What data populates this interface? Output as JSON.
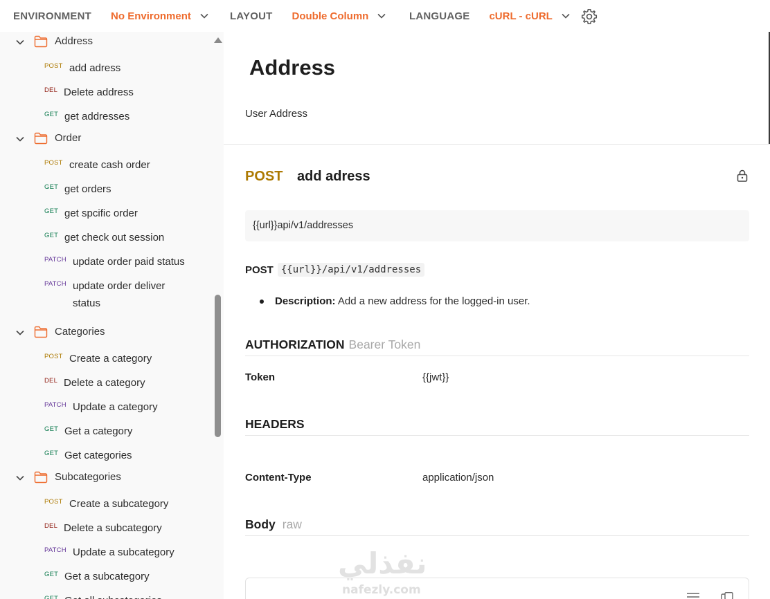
{
  "topbar": {
    "environment_label": "ENVIRONMENT",
    "environment_value": "No Environment",
    "layout_label": "LAYOUT",
    "layout_value": "Double Column",
    "language_label": "LANGUAGE",
    "language_value": "cURL - cURL",
    "accent_color": "#ee6b2d"
  },
  "sidebar": {
    "folders": [
      {
        "name": "Address",
        "requests": [
          {
            "method": "POST",
            "name": "add adress"
          },
          {
            "method": "DEL",
            "name": "Delete address"
          },
          {
            "method": "GET",
            "name": "get addresses"
          }
        ]
      },
      {
        "name": "Order",
        "requests": [
          {
            "method": "POST",
            "name": "create cash order"
          },
          {
            "method": "GET",
            "name": "get orders"
          },
          {
            "method": "GET",
            "name": "get spcific order"
          },
          {
            "method": "GET",
            "name": "get check out session"
          },
          {
            "method": "PATCH",
            "name": "update order paid status"
          },
          {
            "method": "PATCH",
            "name": "update order deliver",
            "name_line2": "status"
          }
        ]
      },
      {
        "name": "Categories",
        "requests": [
          {
            "method": "POST",
            "name": "Create a category"
          },
          {
            "method": "DEL",
            "name": "Delete a category"
          },
          {
            "method": "PATCH",
            "name": "Update a category"
          },
          {
            "method": "GET",
            "name": "Get a category"
          },
          {
            "method": "GET",
            "name": "Get categories"
          }
        ]
      },
      {
        "name": "Subcategories",
        "requests": [
          {
            "method": "POST",
            "name": "Create a subcategory"
          },
          {
            "method": "DEL",
            "name": "Delete a subcategory"
          },
          {
            "method": "PATCH",
            "name": "Update a subcategory"
          },
          {
            "method": "GET",
            "name": "Get a subcategory"
          },
          {
            "method": "GET",
            "name": "Get all subcategories"
          }
        ]
      }
    ]
  },
  "main": {
    "folder_title": "Address",
    "folder_description": "User Address",
    "request": {
      "method": "POST",
      "name": "add adress",
      "url": "{{url}}api/v1/addresses",
      "endpoint_method": "POST",
      "endpoint_path": "{{url}}/api/v1/addresses",
      "description_label": "Description:",
      "description_text": "Add a new address for the logged-in user."
    },
    "authorization": {
      "heading": "AUTHORIZATION",
      "type": "Bearer Token",
      "key": "Token",
      "value": "{{jwt}}"
    },
    "headers": {
      "heading": "HEADERS",
      "key": "Content-Type",
      "value": "application/json"
    },
    "body": {
      "heading": "Body",
      "mode": "raw"
    }
  },
  "watermark": {
    "arabic": "نفذلي",
    "latin": "nafezly.com"
  },
  "colors": {
    "post": "#ad7a03",
    "get": "#0f7b4f",
    "del": "#8e1a10",
    "patch": "#623497",
    "folder": "#ee6b2d"
  }
}
